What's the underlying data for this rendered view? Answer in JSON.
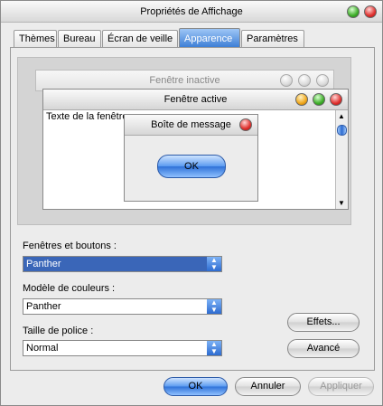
{
  "window": {
    "title": "Propriétés de Affichage"
  },
  "tabs": [
    {
      "label": "Thèmes"
    },
    {
      "label": "Bureau"
    },
    {
      "label": "Écran de veille"
    },
    {
      "label": "Apparence",
      "active": true
    },
    {
      "label": "Paramètres"
    }
  ],
  "preview": {
    "inactive_title": "Fenêtre inactive",
    "active_title": "Fenêtre active",
    "window_text": "Texte de la fenêtre",
    "message_title": "Boîte de message",
    "message_ok": "OK"
  },
  "fields": {
    "windows_buttons_label": "Fenêtres et boutons :",
    "windows_buttons_value": "Panther",
    "color_scheme_label": "Modèle de couleurs :",
    "color_scheme_value": "Panther",
    "font_size_label": "Taille de police :",
    "font_size_value": "Normal"
  },
  "buttons": {
    "effects": "Effets...",
    "advanced": "Avancé",
    "ok": "OK",
    "cancel": "Annuler",
    "apply": "Appliquer"
  }
}
